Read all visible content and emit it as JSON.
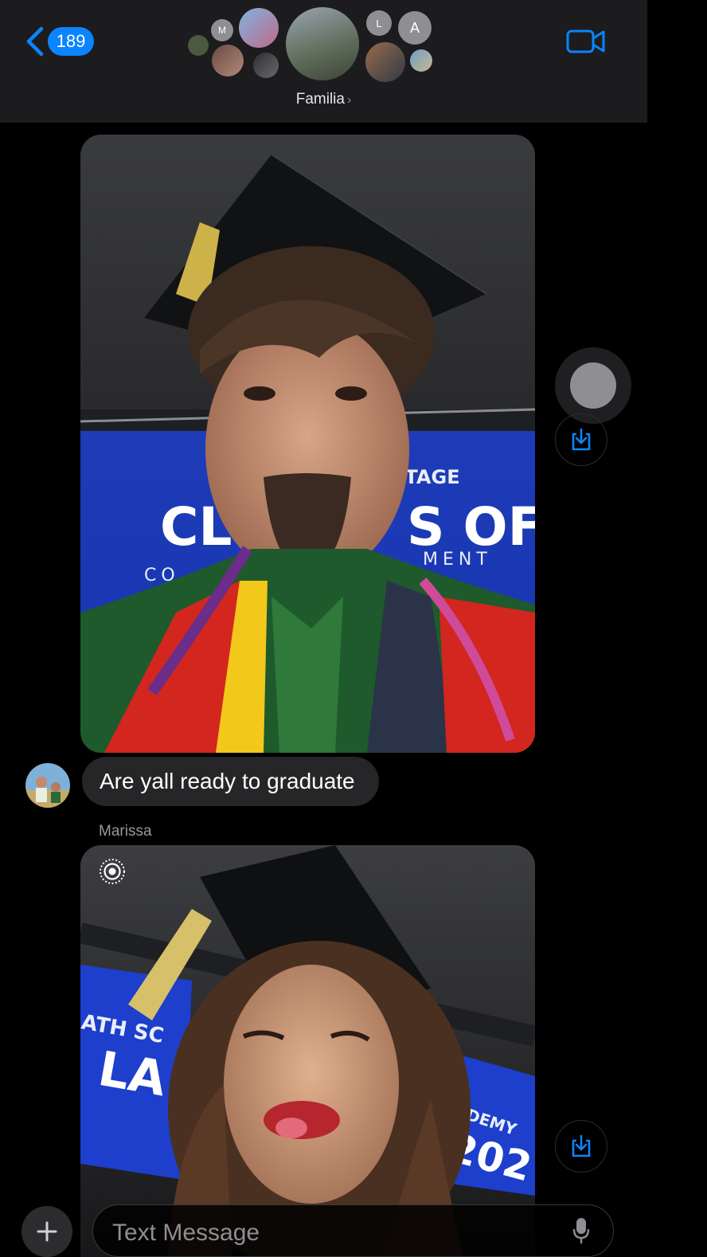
{
  "header": {
    "back_count": "189",
    "group_name": "Familia",
    "avatar_letters": [
      "M",
      "L",
      "A"
    ],
    "icons": {
      "back": "chevron-left-icon",
      "video": "video-camera-icon",
      "chevron": "chevron-right-icon"
    }
  },
  "messages": [
    {
      "type": "photo",
      "subject": "graduation-selfie"
    },
    {
      "type": "text",
      "text": "Are yall ready to graduate"
    },
    {
      "type": "photo",
      "sender": "Marissa",
      "subject": "graduation-selfie",
      "live_photo": true
    }
  ],
  "composer": {
    "placeholder": "Text Message",
    "icons": {
      "add": "plus-icon",
      "mic": "microphone-icon"
    }
  },
  "colors": {
    "accent": "#0a84ff",
    "header_bg": "#1c1c1e",
    "bubble_bg": "#262628",
    "background": "#000000"
  }
}
